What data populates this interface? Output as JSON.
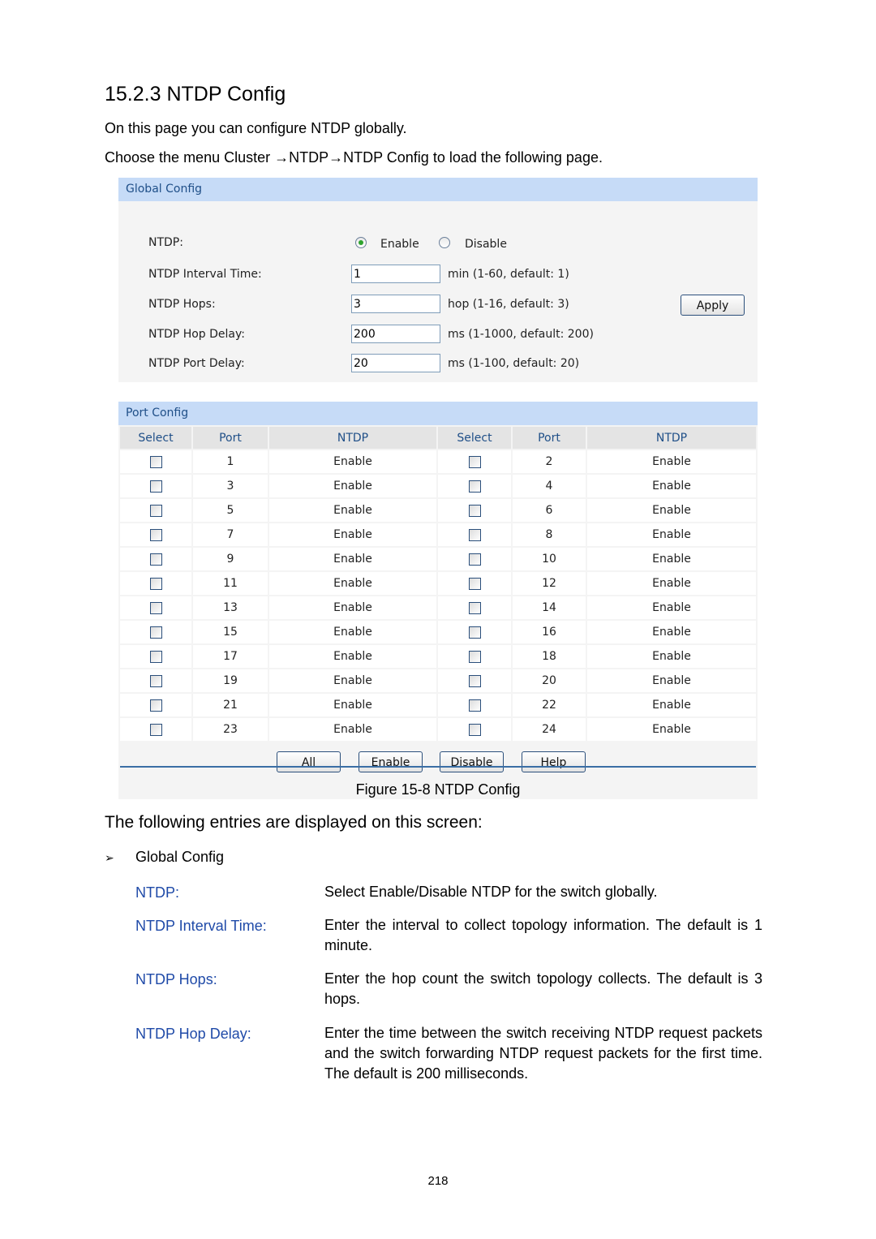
{
  "heading": "15.2.3  NTDP Config",
  "intro": "On this page you can configure NTDP globally.",
  "menu_path": "Choose the menu Cluster →NTDP→NTDP Config  to load the following page.",
  "screenshot": {
    "global_config": {
      "title": "Global Config",
      "ntdp_label": "NTDP:",
      "radio_enable": "Enable",
      "radio_disable": "Disable",
      "selected": "Enable",
      "fields": [
        {
          "label": "NTDP Interval Time:",
          "value": "1",
          "hint": "min (1-60, default: 1)"
        },
        {
          "label": "NTDP Hops:",
          "value": "3",
          "hint": "hop (1-16, default: 3)"
        },
        {
          "label": "NTDP Hop Delay:",
          "value": "200",
          "hint": "ms (1-1000, default: 200)"
        },
        {
          "label": "NTDP Port Delay:",
          "value": "20",
          "hint": "ms (1-100, default: 20)"
        }
      ],
      "apply_label": "Apply"
    },
    "port_config": {
      "title": "Port Config",
      "columns": [
        "Select",
        "Port",
        "NTDP",
        "Select",
        "Port",
        "NTDP"
      ],
      "rows": [
        {
          "left_port": "1",
          "left_ntdp": "Enable",
          "right_port": "2",
          "right_ntdp": "Enable"
        },
        {
          "left_port": "3",
          "left_ntdp": "Enable",
          "right_port": "4",
          "right_ntdp": "Enable"
        },
        {
          "left_port": "5",
          "left_ntdp": "Enable",
          "right_port": "6",
          "right_ntdp": "Enable"
        },
        {
          "left_port": "7",
          "left_ntdp": "Enable",
          "right_port": "8",
          "right_ntdp": "Enable"
        },
        {
          "left_port": "9",
          "left_ntdp": "Enable",
          "right_port": "10",
          "right_ntdp": "Enable"
        },
        {
          "left_port": "11",
          "left_ntdp": "Enable",
          "right_port": "12",
          "right_ntdp": "Enable"
        },
        {
          "left_port": "13",
          "left_ntdp": "Enable",
          "right_port": "14",
          "right_ntdp": "Enable"
        },
        {
          "left_port": "15",
          "left_ntdp": "Enable",
          "right_port": "16",
          "right_ntdp": "Enable"
        },
        {
          "left_port": "17",
          "left_ntdp": "Enable",
          "right_port": "18",
          "right_ntdp": "Enable"
        },
        {
          "left_port": "19",
          "left_ntdp": "Enable",
          "right_port": "20",
          "right_ntdp": "Enable"
        },
        {
          "left_port": "21",
          "left_ntdp": "Enable",
          "right_port": "22",
          "right_ntdp": "Enable"
        },
        {
          "left_port": "23",
          "left_ntdp": "Enable",
          "right_port": "24",
          "right_ntdp": "Enable"
        }
      ],
      "buttons": {
        "all": "All",
        "enable": "Enable",
        "disable": "Disable",
        "help": "Help"
      }
    }
  },
  "figure_caption": "Figure 15-8 NTDP Config",
  "entries_heading": "The following entries are displayed on this screen:",
  "bullet": {
    "icon": "arrow-bullet-icon",
    "glyph": "➢",
    "label": "Global Config"
  },
  "definitions": [
    {
      "term": "NTDP:",
      "desc": "Select Enable/Disable NTDP for the switch globally."
    },
    {
      "term": "NTDP Interval Time:",
      "desc": "Enter the interval to collect topology information. The default is 1 minute."
    },
    {
      "term": "NTDP Hops:",
      "desc": "Enter the hop count the switch topology collects. The default is 3 hops."
    },
    {
      "term": "NTDP Hop Delay:",
      "desc": "Enter the time between the switch receiving NTDP request packets and the switch forwarding NTDP request packets for the first time. The default is 200 milliseconds."
    }
  ],
  "page_number": "218"
}
